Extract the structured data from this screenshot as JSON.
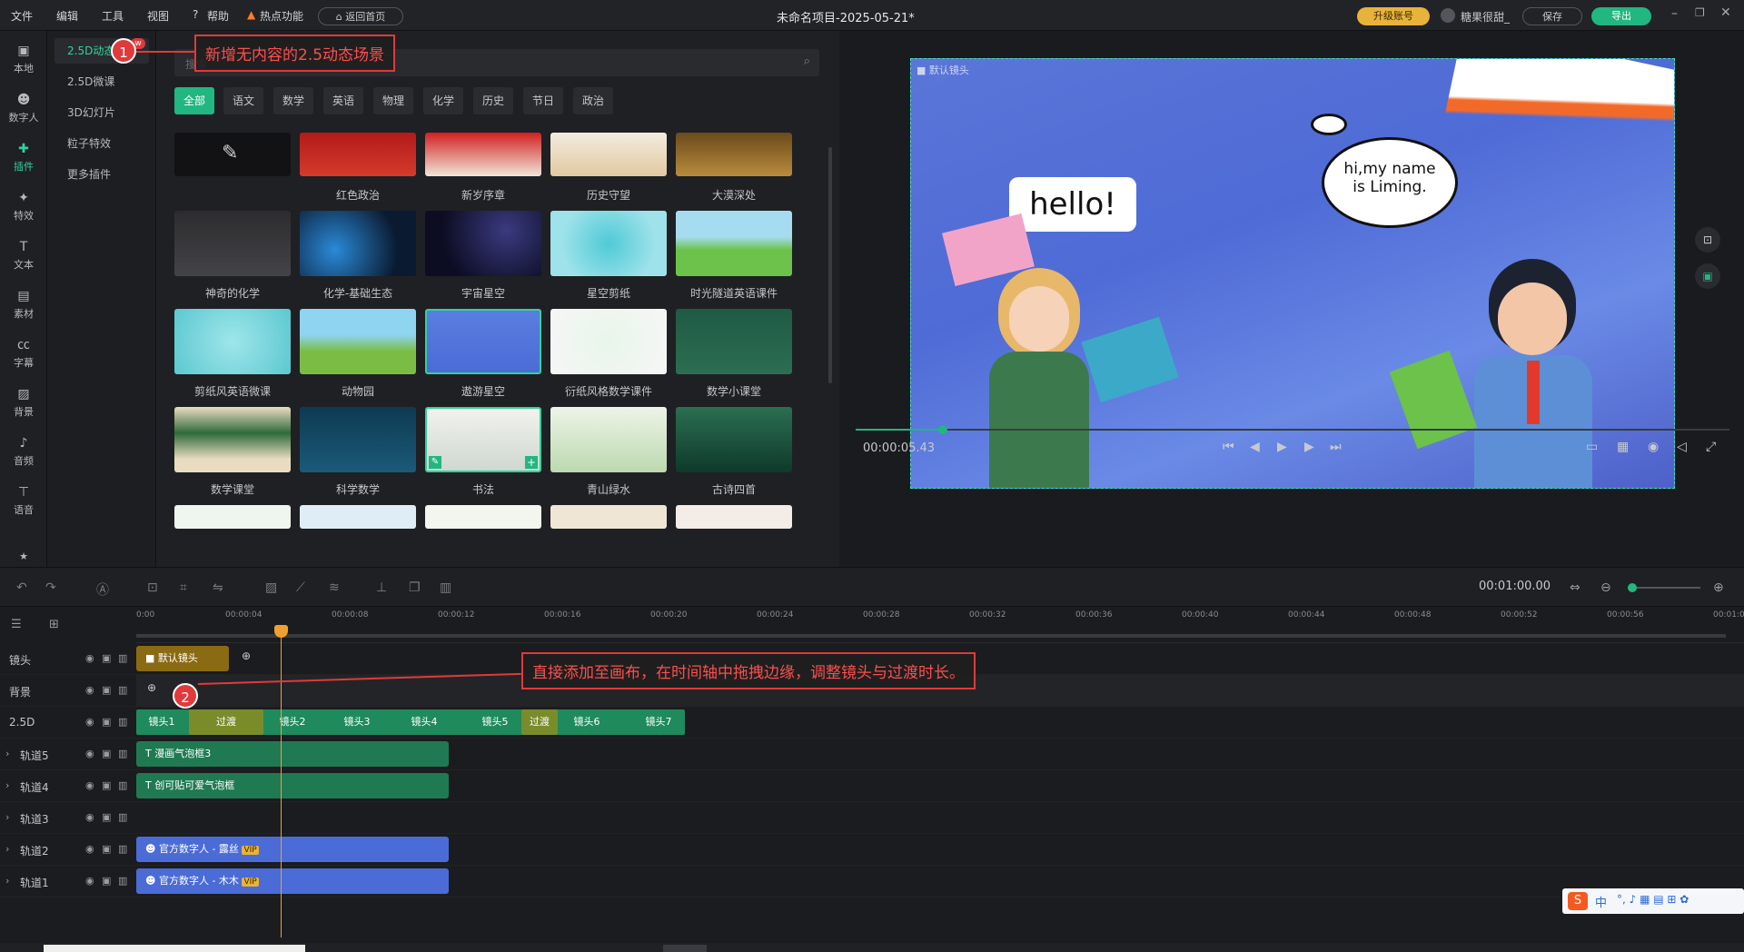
{
  "topbar": {
    "menus": [
      "文件",
      "编辑",
      "工具",
      "视图",
      "帮助",
      "热点功能"
    ],
    "back_home": "返回首页",
    "title": "未命名项目-2025-05-21*",
    "upgrade": "升级账号",
    "user": "糖果很甜_",
    "save": "保存",
    "export": "导出"
  },
  "rail": {
    "items": [
      {
        "label": "本地",
        "icon": "folder-icon"
      },
      {
        "label": "数字人",
        "icon": "person-icon"
      },
      {
        "label": "插件",
        "icon": "plugin-icon"
      },
      {
        "label": "特效",
        "icon": "effects-icon"
      },
      {
        "label": "文本",
        "icon": "text-icon"
      },
      {
        "label": "素材",
        "icon": "material-icon"
      },
      {
        "label": "字幕",
        "icon": "subtitle-icon"
      },
      {
        "label": "背景",
        "icon": "background-icon"
      },
      {
        "label": "音频",
        "icon": "music-icon"
      },
      {
        "label": "语音",
        "icon": "voice-icon"
      }
    ]
  },
  "submenu": {
    "items": [
      "2.5D动态",
      "2.5D微课",
      "3D幻灯片",
      "粒子特效",
      "更多插件"
    ],
    "new_badge": "w"
  },
  "assets": {
    "search_placeholder": "搜索",
    "categories": [
      "全部",
      "语文",
      "数学",
      "英语",
      "物理",
      "化学",
      "历史",
      "节日",
      "政治"
    ],
    "rows": [
      [
        "",
        "红色政治",
        "新岁序章",
        "历史守望",
        "大漠深处"
      ],
      [
        "神奇的化学",
        "化学-基础生态",
        "宇宙星空",
        "星空剪纸",
        "时光隧道英语课件"
      ],
      [
        "剪纸风英语微课",
        "动物园",
        "遨游星空",
        "衍纸风格数学课件",
        "数学小课堂"
      ],
      [
        "数学课堂",
        "科学数学",
        "书法",
        "青山绿水",
        "古诗四首"
      ]
    ]
  },
  "preview": {
    "camera_label": "默认镜头",
    "hello": "hello!",
    "bubble_line1": "hi,my name",
    "bubble_line2": "is Liming.",
    "timecode": "00:00:05.43",
    "progress": 0.1
  },
  "toolbar": {
    "duration": "00:01:00.00"
  },
  "ruler": {
    "ticks": [
      "0:00",
      "00:00:04",
      "00:00:08",
      "00:00:12",
      "00:00:16",
      "00:00:20",
      "00:00:24",
      "00:00:28",
      "00:00:32",
      "00:00:36",
      "00:00:40",
      "00:00:44",
      "00:00:48",
      "00:00:52",
      "00:00:56",
      "00:01:0"
    ]
  },
  "tracks": [
    {
      "name": "镜头"
    },
    {
      "name": "背景"
    },
    {
      "name": "2.5D"
    },
    {
      "name": "轨道5"
    },
    {
      "name": "轨道4"
    },
    {
      "name": "轨道3"
    },
    {
      "name": "轨道2"
    },
    {
      "name": "轨道1"
    }
  ],
  "clips": {
    "camera": "默认镜头",
    "scenes": [
      "镜头1",
      "过渡",
      "镜头2",
      "镜头3",
      "镜头4",
      "镜头5",
      "过渡",
      "镜头6",
      "镜头7"
    ],
    "track5": "漫画气泡框3",
    "track4": "创可贴可爱气泡框",
    "track2": "官方数字人 - 露丝",
    "track1": "官方数字人 - 木木",
    "vip": "VIP"
  },
  "annotations": {
    "one_num": "1",
    "one_text": "新增无内容的2.5动态场景",
    "two_num": "2",
    "two_text": "直接添加至画布，在时间轴中拖拽边缘，调整镜头与过渡时长。"
  },
  "ime": {
    "label": "中"
  },
  "colors": {
    "accent": "#22b680",
    "upgrade": "#e8b33a",
    "annotation": "#e03a3a",
    "digital_human": "#4b6bd6",
    "scene_green": "#1f8a5c"
  }
}
